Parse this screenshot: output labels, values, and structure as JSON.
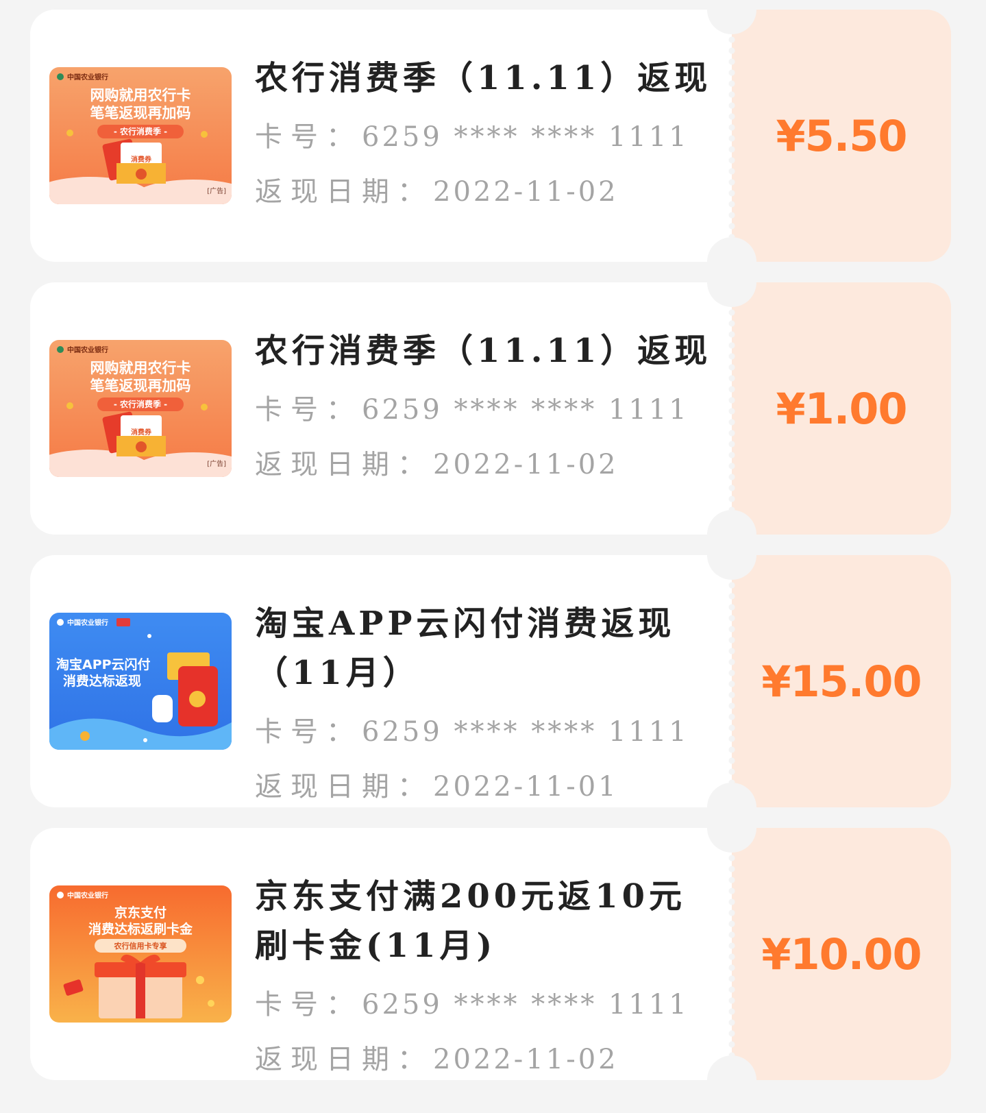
{
  "cards": [
    {
      "title": "农行消费季（11.11）返现",
      "card_label": "卡号：",
      "card_number": "6259 **** **** 1111",
      "date_label": "返现日期：",
      "date": "2022-11-02",
      "amount": "¥5.50",
      "banner": {
        "bank": "中国农业银行",
        "line1": "网购就用农行卡",
        "line2": "笔笔返现再加码",
        "tag": "- 农行消费季 -",
        "coupon": "消费券",
        "ad": "[广告]"
      }
    },
    {
      "title": "农行消费季（11.11）返现",
      "card_label": "卡号：",
      "card_number": "6259 **** **** 1111",
      "date_label": "返现日期：",
      "date": "2022-11-02",
      "amount": "¥1.00",
      "banner": {
        "bank": "中国农业银行",
        "line1": "网购就用农行卡",
        "line2": "笔笔返现再加码",
        "tag": "- 农行消费季 -",
        "coupon": "消费券",
        "ad": "[广告]"
      }
    },
    {
      "title": "淘宝APP云闪付消费返现（11月）",
      "card_label": "卡号：",
      "card_number": "6259 **** **** 1111",
      "date_label": "返现日期：",
      "date": "2022-11-01",
      "amount": "¥15.00",
      "banner": {
        "bank": "中国农业银行",
        "line1": "淘宝APP云闪付",
        "line2": "消费达标返现"
      }
    },
    {
      "title": "京东支付满200元返10元刷卡金(11月)",
      "card_label": "卡号：",
      "card_number": "6259 **** **** 1111",
      "date_label": "返现日期：",
      "date": "2022-11-02",
      "amount": "¥10.00",
      "banner": {
        "bank": "中国农业银行",
        "line1": "京东支付",
        "line2": "消费达标返刷卡金",
        "tag": "农行信用卡专享"
      }
    }
  ],
  "colors": {
    "page_bg": "#f4f4f4",
    "card_bg": "#ffffff",
    "stub_bg": "#fde9dd",
    "amount": "#ff7a2e",
    "title": "#222222",
    "meta": "#a4a4a4"
  }
}
